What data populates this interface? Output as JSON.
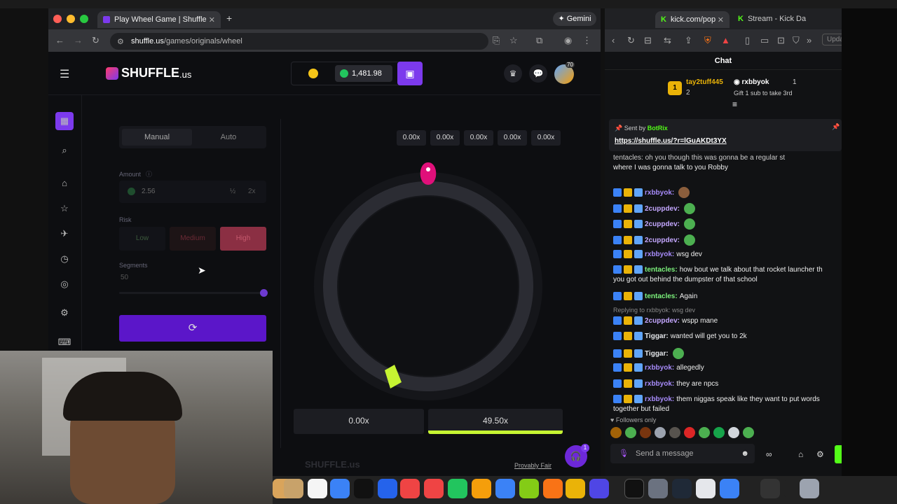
{
  "browser_left": {
    "tab_title": "Play Wheel Game | Shuffle",
    "new_tab": "+",
    "gemini_label": "Gemini",
    "url_domain": "shuffle.us",
    "url_path": "/games/originals/wheel"
  },
  "browser_right": {
    "tab1_title": "kick.com/pop",
    "tab2_title": "Stream - Kick Da",
    "update_label": "Upda"
  },
  "site": {
    "logo_text": "SHUFFLE",
    "logo_suffix": ".us",
    "balance": "1,481.98",
    "avatar_level": "70",
    "footer_logo": "SHUFFLE.us",
    "provably_fair": "Provably Fair",
    "support_badge": "1"
  },
  "bet_panel": {
    "tab_manual": "Manual",
    "tab_auto": "Auto",
    "amount_label": "Amount",
    "amount_value": "2.56",
    "half": "½",
    "double": "2x",
    "risk_label": "Risk",
    "risk_low": "Low",
    "risk_medium": "Medium",
    "risk_high": "High",
    "risk_selected": "High",
    "segments_label": "Segments",
    "segments_value": "50",
    "segments_slider_level": 1.0
  },
  "wheel": {
    "history": [
      "0.00x",
      "0.00x",
      "0.00x",
      "0.00x",
      "0.00x"
    ],
    "result_left": "0.00x",
    "result_right": "49.50x",
    "accent_color": "#c6f432",
    "pointer_color": "#e0107a"
  },
  "chat": {
    "title": "Chat",
    "leader1_rank": "1",
    "leader1_name": "tay2tuff445",
    "leader1_subs": "2",
    "leader2_name": "rxbbyok",
    "leader2_subs": "1",
    "leader2_note": "Gift 1 sub to take 3rd",
    "pinned_by_prefix": "Sent by",
    "pinned_by": "BotRix",
    "pinned_link": "https://shuffle.us/?r=lGuAKDt3YX",
    "partial_line": "tentacles: oh you though this was gonna be a regular st",
    "partial_line2": "where I was gonna talk to you Robby",
    "messages": [
      {
        "user": "rxbbyok",
        "text": "",
        "color": "#a78bfa"
      },
      {
        "user": "2cuppdev",
        "text": "",
        "color": "#c4a7ff"
      },
      {
        "user": "2cuppdev",
        "text": "",
        "color": "#c4a7ff"
      },
      {
        "user": "2cuppdev",
        "text": "",
        "color": "#c4a7ff"
      },
      {
        "user": "rxbbyok",
        "text": "wsg dev",
        "color": "#a78bfa"
      },
      {
        "user": "tentacles",
        "text": "how bout we talk about that rocket launcher th",
        "color": "#7cf27c"
      },
      {
        "user": "",
        "text": "you got out behind the dumpster of that school",
        "color": ""
      },
      {
        "user": "tentacles",
        "text": "Again",
        "color": "#7cf27c"
      },
      {
        "user": "",
        "text": "Replying to rxbbyok: wsg dev",
        "color": ""
      },
      {
        "user": "2cuppdev",
        "text": "wspp mane",
        "color": "#c4a7ff"
      },
      {
        "user": "Tiggar",
        "text": "wanted will get you to 2k",
        "color": "#e5e7eb"
      },
      {
        "user": "Tiggar",
        "text": "",
        "color": "#e5e7eb"
      },
      {
        "user": "rxbbyok",
        "text": "allegedly",
        "color": "#a78bfa"
      },
      {
        "user": "rxbbyok",
        "text": "they are npcs",
        "color": "#a78bfa"
      },
      {
        "user": "rxbbyok",
        "text": "them niggas speak like they want to put words",
        "color": "#a78bfa"
      },
      {
        "user": "",
        "text": "together but failed",
        "color": ""
      }
    ],
    "followers_only": "Followers only",
    "input_placeholder": "Send a message"
  }
}
